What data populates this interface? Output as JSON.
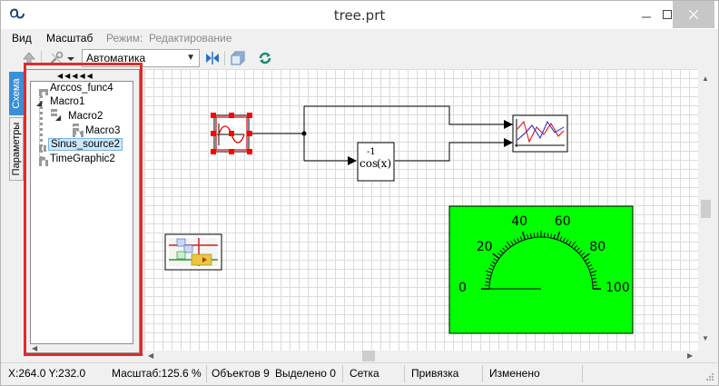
{
  "window": {
    "title": "tree.prt"
  },
  "menu": {
    "view": "Вид",
    "scale": "Масштаб",
    "mode_label": "Режим:",
    "mode_value": "Редактирование"
  },
  "toolbar": {
    "scale_combo_value": "Автоматика",
    "icons": [
      "arrow-up-icon",
      "tools-icon",
      "dropdown-arrow-icon",
      "fit-view-icon",
      "layers-icon",
      "refresh-icon"
    ]
  },
  "side_tabs": {
    "scheme": "Схема",
    "parameters": "Параметры"
  },
  "tree": {
    "items": [
      {
        "label": "Arccos_func4",
        "level": 0,
        "expanded": false
      },
      {
        "label": "Macro1",
        "level": 0,
        "expanded": true
      },
      {
        "label": "Macro2",
        "level": 1,
        "expanded": true
      },
      {
        "label": "Macro3",
        "level": 2,
        "expanded": false
      },
      {
        "label": "Sinus_source2",
        "level": 0,
        "selected": true
      },
      {
        "label": "TimeGraphic2",
        "level": 0,
        "expanded": false
      }
    ]
  },
  "diagram": {
    "cos_block": {
      "main": "cos",
      "superscript": "-1",
      "arg": "(x)"
    },
    "gauge": {
      "background": "#00ff00",
      "labels": [
        "0",
        "20",
        "40",
        "60",
        "80",
        "100"
      ]
    },
    "selection_color": "#ff0000"
  },
  "status": {
    "coords": "X:264.0  Y:232.0",
    "scale": "Масштаб:125.6 %",
    "objects": "Объектов 9",
    "selected": "Выделено 0",
    "grid": "Сетка",
    "snap": "Привязка",
    "modified": "Изменено"
  }
}
